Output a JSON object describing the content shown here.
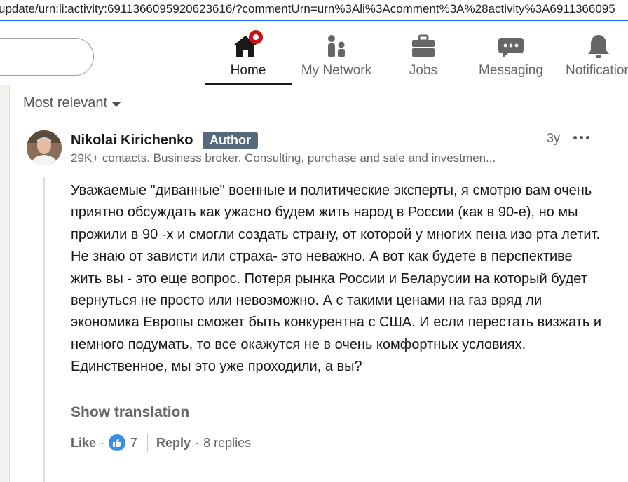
{
  "browser": {
    "url": "update/urn:li:activity:6911366095920623616/?commentUrn=urn%3Ali%3Acomment%3A%28activity%3A6911366095"
  },
  "nav": {
    "items": [
      {
        "label": "Home",
        "icon": "home-icon"
      },
      {
        "label": "My Network",
        "icon": "network-icon"
      },
      {
        "label": "Jobs",
        "icon": "briefcase-icon"
      },
      {
        "label": "Messaging",
        "icon": "chat-icon"
      },
      {
        "label": "Notification",
        "icon": "bell-icon"
      }
    ],
    "active": "Home"
  },
  "sort": {
    "label": "Most relevant"
  },
  "comment": {
    "author": "Nikolai Kirichenko",
    "badge": "Author",
    "headline": "29K+ contacts. Business broker. Consulting, purchase and sale and investmen...",
    "time": "3y",
    "body": "Уважаемые \"диванные\" военные и политические эксперты, я смотрю вам очень приятно обсуждать как ужасно будем жить народ в России (как в 90-е), но мы прожили в 90 -х и смогли создать страну, от которой у многих пена изо рта летит. Не знаю от зависти или страха- это неважно. А вот как будете в перспективе жить вы - это еще вопрос. Потеря рынка России и Беларусии на который будет вернуться не просто или невозможно. А с такими ценами на газ вряд ли экономика Европы сможет быть конкурентна с США. И если перестать визжать и немного подумать, то все окажутся не в очень комфортных условиях. Единственное, мы это уже проходили, а вы?",
    "show_translation": "Show translation",
    "like_label": "Like",
    "like_count": "7",
    "reply_label": "Reply",
    "replies": "8 replies"
  },
  "colors": {
    "notification_badge": "#cc1016",
    "author_badge": "#56687a",
    "like_reaction": "#378fe9"
  }
}
